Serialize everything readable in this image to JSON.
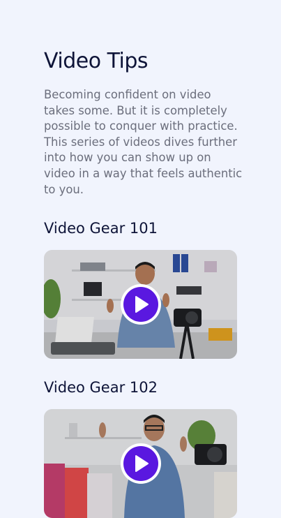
{
  "page": {
    "title": "Video Tips",
    "intro": "Becoming confident on video takes some. But it is completely possible to conquer with practice. This series of videos dives further into how you can show up on video in a way that feels authentic to you."
  },
  "videos": [
    {
      "title": "Video Gear 101",
      "icon": "play-icon"
    },
    {
      "title": "Video Gear 102",
      "icon": "play-icon"
    }
  ],
  "colors": {
    "background": "#f1f4fd",
    "heading": "#0e1438",
    "body_text": "#6b6e7c",
    "accent": "#5a18e0"
  }
}
